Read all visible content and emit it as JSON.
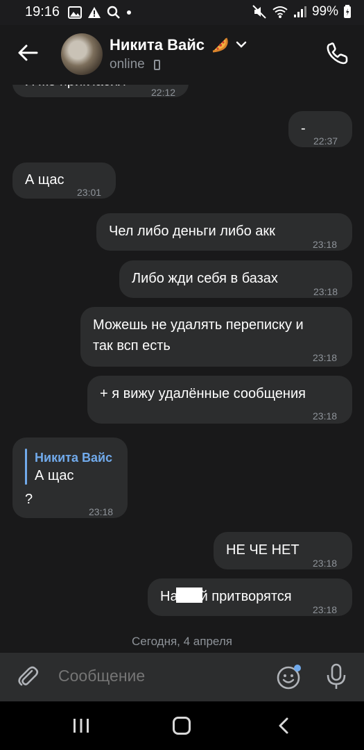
{
  "status_bar": {
    "time": "19:16",
    "battery": "99%"
  },
  "header": {
    "name": "Никита Вайс",
    "presence": "online"
  },
  "messages": [
    {
      "id": "m0",
      "side": "in",
      "text": "Я же пригласил",
      "time": "22:12"
    },
    {
      "id": "m1",
      "side": "out",
      "text": "-",
      "time": "22:37"
    },
    {
      "id": "m2",
      "side": "in",
      "text": "А щас",
      "time": "23:01"
    },
    {
      "id": "m3",
      "side": "out",
      "text": "Чел либо деньги либо акк",
      "time": "23:18"
    },
    {
      "id": "m4",
      "side": "out",
      "text": "Либо жди себя в базах",
      "time": "23:18"
    },
    {
      "id": "m5",
      "side": "out",
      "line1": "Можешь не удалять переписку и",
      "line2": "так всп есть",
      "time": "23:18"
    },
    {
      "id": "m6",
      "side": "out",
      "text": "+ я вижу удалённые сообщения",
      "time": "23:18"
    },
    {
      "id": "m7",
      "side": "in",
      "reply_name": "Никита Вайс",
      "reply_text": "А щас",
      "text": "?",
      "time": "23:18"
    },
    {
      "id": "m8",
      "side": "out",
      "text": "НЕ ЧЕ НЕТ",
      "time": "23:18"
    },
    {
      "id": "m9",
      "side": "out",
      "text_start": "На",
      "text_end": "й притворятся",
      "time": "23:18"
    }
  ],
  "date_separator": "Сегодня, 4 апреля",
  "composer": {
    "placeholder": "Сообщение"
  }
}
